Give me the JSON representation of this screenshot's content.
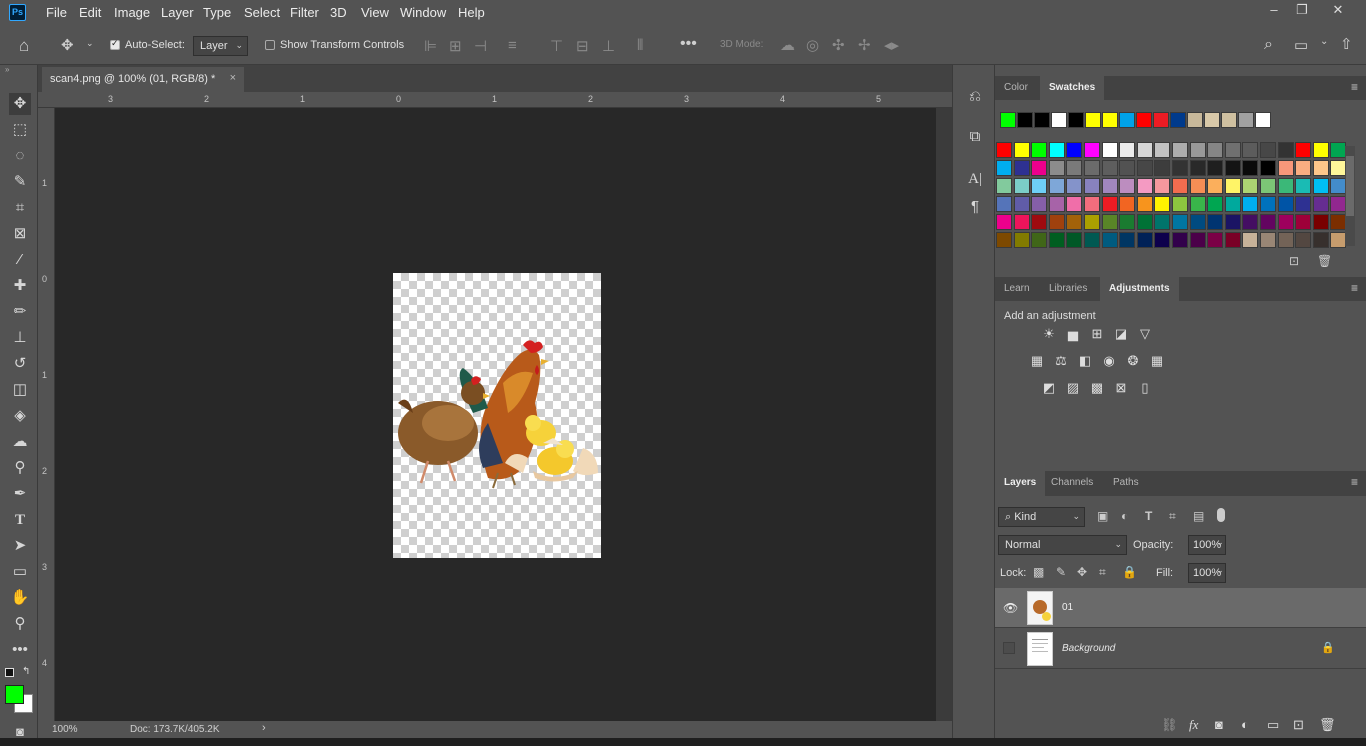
{
  "app": {
    "logo": "Ps"
  },
  "menu": [
    "File",
    "Edit",
    "Image",
    "Layer",
    "Type",
    "Select",
    "Filter",
    "3D",
    "View",
    "Window",
    "Help"
  ],
  "options_bar": {
    "auto_select_label": "Auto-Select:",
    "auto_select_value": "Layer",
    "show_transform_label": "Show Transform Controls",
    "mode_3d_label": "3D Mode:"
  },
  "document": {
    "tab_title": "scan4.png @ 100% (01, RGB/8) *",
    "close": "×",
    "zoom": "100%",
    "doc_info": "Doc: 173.7K/405.2K"
  },
  "ruler_top": [
    "3",
    "2",
    "1",
    "0",
    "1",
    "2",
    "3",
    "4",
    "5"
  ],
  "ruler_left": [
    "1",
    "0",
    "1",
    "2",
    "3",
    "4"
  ],
  "colors": {
    "foreground": "#00ff00",
    "background": "#ffffff"
  },
  "color_panel": {
    "tabs": [
      "Color",
      "Swatches"
    ],
    "active_tab": "Swatches",
    "recent_swatches": [
      "#00ff00",
      "#000000",
      "#000000",
      "#ffffff",
      "#000000",
      "#ffff00",
      "#ffff00",
      "#00a2e8",
      "#ff0000",
      "#ed1c24",
      "#003a8c",
      "#c8b89a",
      "#d8c8a8",
      "#cfc0a0",
      "#a0a0a0",
      "#ffffff"
    ],
    "grid_rows": [
      [
        "#ff0000",
        "#ffff00",
        "#00ff00",
        "#00ffff",
        "#0000ff",
        "#ff00ff",
        "#ffffff",
        "#ebebeb",
        "#d6d6d6",
        "#c2c2c2",
        "#adadad",
        "#999999",
        "#858585",
        "#707070",
        "#5c5c5c",
        "#474747",
        "#333333",
        "#ff0000",
        "#ffff00",
        "#00a651"
      ],
      [
        "#00aeef",
        "#2e3192",
        "#ec008c",
        "#8c8c8c",
        "#7a7a7a",
        "#6b6b6b",
        "#5e5e5e",
        "#525252",
        "#474747",
        "#3d3d3d",
        "#333333",
        "#292929",
        "#1f1f1f",
        "#141414",
        "#0a0a0a",
        "#000000",
        "#f7977a",
        "#f9ad81",
        "#fdc68a",
        "#fff79a"
      ],
      [
        "#82ca9d",
        "#7bcdc8",
        "#6ecff6",
        "#7ea7d8",
        "#8493ca",
        "#8882be",
        "#a187be",
        "#bc8dbf",
        "#f49ac2",
        "#f6989d",
        "#f26c4f",
        "#f68e55",
        "#fbaf5c",
        "#fff467",
        "#acd372",
        "#7cc576",
        "#3bb878",
        "#1abbb4",
        "#00bff3",
        "#438ccb"
      ],
      [
        "#5574b9",
        "#605ca8",
        "#855fa8",
        "#a763a8",
        "#f06ea9",
        "#f26d7d",
        "#ed1c24",
        "#f26522",
        "#f7941d",
        "#fff200",
        "#8dc63f",
        "#39b54a",
        "#00a651",
        "#00a99d",
        "#00aeef",
        "#0072bc",
        "#0054a6",
        "#2e3192",
        "#662d91",
        "#92278f"
      ],
      [
        "#ec008c",
        "#ed145b",
        "#9e0b0f",
        "#a0410d",
        "#a36209",
        "#aba000",
        "#598527",
        "#1a7b30",
        "#007236",
        "#00746b",
        "#0076a3",
        "#004b80",
        "#003471",
        "#1b1464",
        "#440e62",
        "#630460",
        "#9e005d",
        "#9e0039",
        "#790000",
        "#7b2e00"
      ],
      [
        "#7d4900",
        "#827b00",
        "#406618",
        "#005e20",
        "#005826",
        "#005952",
        "#005b7f",
        "#003663",
        "#002157",
        "#0d004c",
        "#32004b",
        "#4b0049",
        "#7b0046",
        "#7a0026",
        "#c7b299",
        "#998675",
        "#736357",
        "#534741",
        "#37302d",
        "#c69c6d"
      ]
    ]
  },
  "adjust_panel": {
    "tabs": [
      "Learn",
      "Libraries",
      "Adjustments"
    ],
    "active_tab": "Adjustments",
    "heading": "Add an adjustment",
    "icons_row1": [
      "brightness-contrast-icon",
      "levels-icon",
      "curves-icon",
      "exposure-icon",
      "vibrance-icon"
    ],
    "icons_row2": [
      "hue-saturation-icon",
      "color-balance-icon",
      "black-white-icon",
      "photo-filter-icon",
      "channel-mixer-icon",
      "color-lookup-icon"
    ],
    "icons_row3": [
      "invert-icon",
      "posterize-icon",
      "threshold-icon",
      "selective-color-icon",
      "gradient-map-icon"
    ]
  },
  "layers_panel": {
    "tabs": [
      "Layers",
      "Channels",
      "Paths"
    ],
    "active_tab": "Layers",
    "filter_kind": "Kind",
    "blend_mode": "Normal",
    "opacity_label": "Opacity:",
    "opacity_value": "100%",
    "lock_label": "Lock:",
    "fill_label": "Fill:",
    "fill_value": "100%",
    "layers": [
      {
        "name": "01",
        "visible": true,
        "selected": true
      },
      {
        "name": "Background",
        "visible": false,
        "locked": true
      }
    ]
  }
}
